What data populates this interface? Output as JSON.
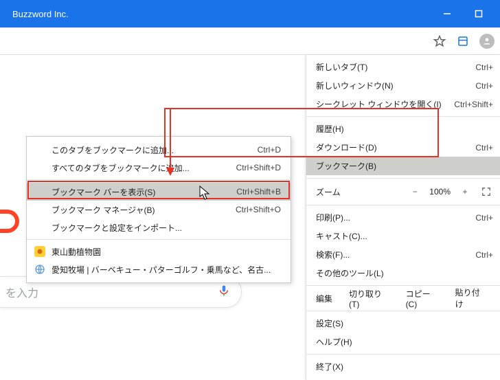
{
  "window": {
    "title": "Buzzword Inc."
  },
  "main_menu": {
    "new_tab": {
      "label": "新しいタブ(T)",
      "accel": "Ctrl+"
    },
    "new_window": {
      "label": "新しいウィンドウ(N)",
      "accel": "Ctrl+"
    },
    "incognito": {
      "label": "シークレット ウィンドウを開く(I)",
      "accel": "Ctrl+Shift+"
    },
    "history": {
      "label": "履歴(H)"
    },
    "downloads": {
      "label": "ダウンロード(D)",
      "accel": "Ctrl+"
    },
    "bookmarks": {
      "label": "ブックマーク(B)"
    },
    "zoom": {
      "label": "ズーム",
      "value": "100%",
      "minus": "−",
      "plus": "+"
    },
    "print": {
      "label": "印刷(P)...",
      "accel": "Ctrl+"
    },
    "cast": {
      "label": "キャスト(C)..."
    },
    "find": {
      "label": "検索(F)...",
      "accel": "Ctrl+"
    },
    "more_tools": {
      "label": "その他のツール(L)"
    },
    "edit": {
      "label": "編集",
      "cut": "切り取り(T)",
      "copy": "コピー(C)",
      "paste": "貼り付け"
    },
    "settings": {
      "label": "設定(S)"
    },
    "help": {
      "label": "ヘルプ(H)"
    },
    "exit": {
      "label": "終了(X)"
    }
  },
  "sub_menu": {
    "bookmark_tab": {
      "label": "このタブをブックマークに追加...",
      "accel": "Ctrl+D"
    },
    "bookmark_all": {
      "label": "すべてのタブをブックマークに追加...",
      "accel": "Ctrl+Shift+D"
    },
    "show_bar": {
      "label": "ブックマーク バーを表示(S)",
      "accel": "Ctrl+Shift+B"
    },
    "manager": {
      "label": "ブックマーク マネージャ(B)",
      "accel": "Ctrl+Shift+O"
    },
    "import": {
      "label": "ブックマークと設定をインポート..."
    },
    "bm1": {
      "label": "東山動植物園"
    },
    "bm2": {
      "label": "愛知牧場 | バーベキュー・パターゴルフ・乗馬など、名古..."
    }
  },
  "search": {
    "placeholder": "を入力"
  }
}
